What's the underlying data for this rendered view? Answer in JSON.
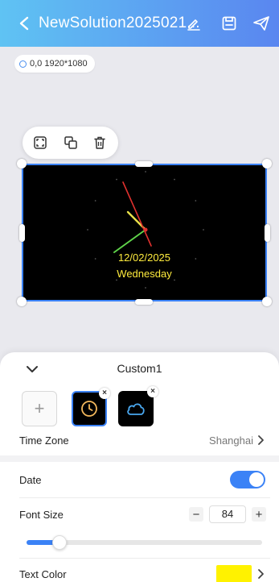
{
  "header": {
    "title": "NewSolution2025021..."
  },
  "canvas_info": {
    "coords": "0,0 1920*1080"
  },
  "clock": {
    "date": "12/02/2025",
    "day": "Wednesday",
    "text_color": "#ffec3d",
    "hour_hand_color": "#e8e04a",
    "minute_hand_color": "#5fd34a",
    "second_hand_color": "#e0312e"
  },
  "panel": {
    "title": "Custom1",
    "add_label": "+",
    "tile_close": "×",
    "time_zone": {
      "label": "Time Zone",
      "value": "Shanghai"
    },
    "date": {
      "label": "Date",
      "enabled": true
    },
    "font_size": {
      "label": "Font Size",
      "value": "84",
      "minus": "−",
      "plus": "+",
      "slider_fraction": 0.14
    },
    "text_color": {
      "label": "Text Color",
      "color": "#fff200"
    }
  },
  "colors": {
    "accent": "#3b82f6"
  }
}
